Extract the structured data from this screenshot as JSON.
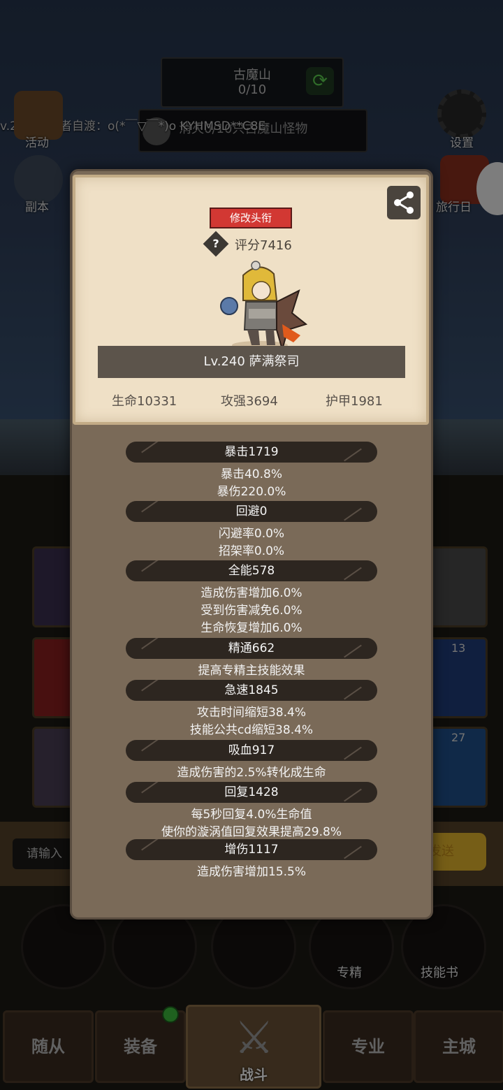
{
  "background": {
    "stage": {
      "name": "古魔山",
      "progress": "0/10"
    },
    "task": "消灭0/10只古魔山怪物",
    "chat": "v.295 搜寻者自渡：o(*￣▽￣*)o KYHMSD**C8E",
    "left_icons": [
      {
        "label": "活动"
      },
      {
        "label": "副本"
      }
    ],
    "right_icons": [
      {
        "label": "设置"
      },
      {
        "label": "旅行日"
      }
    ],
    "slot_counts": [
      "13",
      "27"
    ],
    "input_placeholder": "请输入",
    "send_label": "发送",
    "action_buttons": [
      {
        "label": "专精"
      },
      {
        "label": "技能书"
      }
    ],
    "nav_tabs": [
      {
        "label": "随从"
      },
      {
        "label": "装备"
      },
      {
        "label": "战斗"
      },
      {
        "label": "专业"
      },
      {
        "label": "主城"
      }
    ]
  },
  "profile": {
    "change_title_button": "修改头衔",
    "score": "评分7416",
    "level_name": "Lv.240 萨满祭司",
    "base_stats": {
      "hp": "生命10331",
      "attack": "攻强3694",
      "armor": "护甲1981"
    }
  },
  "stats": [
    {
      "name": "暴击1719",
      "lines": [
        "暴击40.8%",
        "暴伤220.0%"
      ]
    },
    {
      "name": "回避0",
      "lines": [
        "闪避率0.0%",
        "招架率0.0%"
      ]
    },
    {
      "name": "全能578",
      "lines": [
        "造成伤害增加6.0%",
        "受到伤害减免6.0%",
        "生命恢复增加6.0%"
      ]
    },
    {
      "name": "精通662",
      "lines": [
        "提高专精主技能效果"
      ]
    },
    {
      "name": "急速1845",
      "lines": [
        "攻击时间缩短38.4%",
        "技能公共cd缩短38.4%"
      ]
    },
    {
      "name": "吸血917",
      "lines": [
        "造成伤害的2.5%转化成生命"
      ]
    },
    {
      "name": "回复1428",
      "lines": [
        "每5秒回复4.0%生命值",
        "使你的漩涡值回复效果提高29.8%"
      ]
    },
    {
      "name": "增伤1117",
      "lines": [
        "造成伤害增加15.5%"
      ]
    }
  ],
  "colors": {
    "change_title_button": "#d23833",
    "card_bg": "#efe0c6",
    "panel_bg": "#7a6a58",
    "pill_bg": "#2d2620"
  }
}
